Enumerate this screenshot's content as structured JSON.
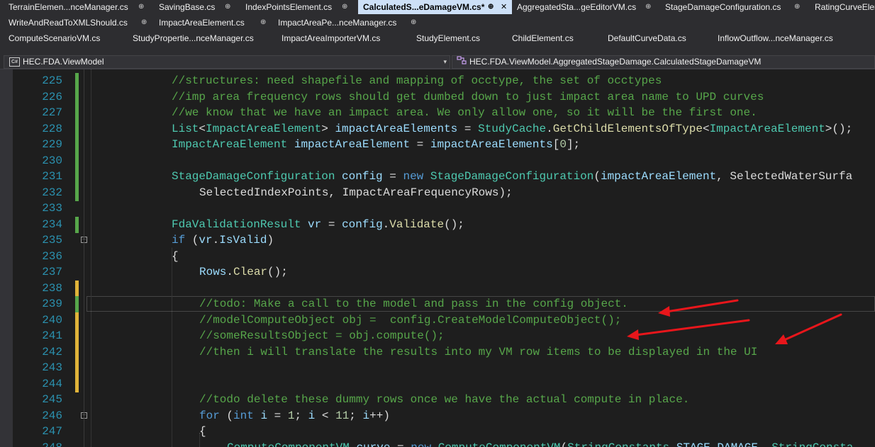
{
  "tabs": {
    "row1": [
      {
        "label": "TerrainElemen...nceManager.cs",
        "pin": "⊕"
      },
      {
        "label": "SavingBase.cs",
        "pin": "⊕"
      },
      {
        "label": "IndexPointsElement.cs",
        "pin": "⊕"
      },
      {
        "label": "CalculatedS...eDamageVM.cs*",
        "pin": "⊕",
        "close": "✕"
      },
      {
        "label": "AggregatedSta...geEditorVM.cs",
        "pin": "⊕"
      },
      {
        "label": "StageDamageConfiguration.cs",
        "pin": "⊕"
      },
      {
        "label": "RatingCurveEler"
      }
    ],
    "row2": [
      {
        "label": "WriteAndReadToXMLShould.cs",
        "pin": "⊕"
      },
      {
        "label": "ImpactAreaElement.cs",
        "pin": "⊕"
      },
      {
        "label": "ImpactAreaPe...nceManager.cs",
        "pin": "⊕"
      }
    ],
    "row3": [
      {
        "label": "ComputeScenarioVM.cs"
      },
      {
        "label": "StudyPropertie...nceManager.cs"
      },
      {
        "label": "ImpactAreaImporterVM.cs"
      },
      {
        "label": "StudyElement.cs"
      },
      {
        "label": "ChildElement.cs"
      },
      {
        "label": "DefaultCurveData.cs"
      },
      {
        "label": "InflowOutflow...nceManager.cs"
      }
    ]
  },
  "navbar": {
    "project": "HEC.FDA.ViewModel",
    "project_icon": "C#",
    "type_path": "HEC.FDA.ViewModel.AggregatedStageDamage.CalculatedStageDamageVM",
    "type_icon": "class-icon"
  },
  "editor": {
    "lines": [
      {
        "n": "225",
        "chg": "green",
        "indent": 0,
        "tokens": [
          [
            "cm",
            "//structures: need shapefile and mapping of occtype, the set of occtypes"
          ]
        ]
      },
      {
        "n": "226",
        "chg": "green",
        "indent": 0,
        "tokens": [
          [
            "cm",
            "//imp area frequency rows should get dumbed down to just impact area name to UPD curves"
          ]
        ]
      },
      {
        "n": "227",
        "chg": "green",
        "indent": 0,
        "tokens": [
          [
            "cm",
            "//we know that we have an impact area. We only allow one, so it will be the first one."
          ]
        ]
      },
      {
        "n": "228",
        "chg": "green",
        "indent": 0,
        "tokens": [
          [
            "ty",
            "List"
          ],
          [
            "pl",
            "<"
          ],
          [
            "ty",
            "ImpactAreaElement"
          ],
          [
            "pl",
            "> "
          ],
          [
            "id",
            "impactAreaElements"
          ],
          [
            "pl",
            " = "
          ],
          [
            "ty",
            "StudyCache"
          ],
          [
            "pl",
            "."
          ],
          [
            "mt",
            "GetChildElementsOfType"
          ],
          [
            "pl",
            "<"
          ],
          [
            "ty",
            "ImpactAreaElement"
          ],
          [
            "pl",
            ">();"
          ]
        ]
      },
      {
        "n": "229",
        "chg": "green",
        "indent": 0,
        "tokens": [
          [
            "ty",
            "ImpactAreaElement"
          ],
          [
            "pl",
            " "
          ],
          [
            "id",
            "impactAreaElement"
          ],
          [
            "pl",
            " = "
          ],
          [
            "id",
            "impactAreaElements"
          ],
          [
            "pl",
            "["
          ],
          [
            "nm",
            "0"
          ],
          [
            "pl",
            "];"
          ]
        ]
      },
      {
        "n": "230",
        "chg": "green",
        "indent": 0,
        "tokens": []
      },
      {
        "n": "231",
        "chg": "green",
        "indent": 0,
        "tokens": [
          [
            "ty",
            "StageDamageConfiguration"
          ],
          [
            "pl",
            " "
          ],
          [
            "id",
            "config"
          ],
          [
            "pl",
            " = "
          ],
          [
            "kw",
            "new"
          ],
          [
            "pl",
            " "
          ],
          [
            "ty",
            "StageDamageConfiguration"
          ],
          [
            "pl",
            "("
          ],
          [
            "id",
            "impactAreaElement"
          ],
          [
            "pl",
            ", SelectedWaterSurfa"
          ]
        ]
      },
      {
        "n": "232",
        "chg": "green",
        "indent": 1,
        "tokens": [
          [
            "pl",
            "SelectedIndexPoints, ImpactAreaFrequencyRows);"
          ]
        ]
      },
      {
        "n": "233",
        "chg": "",
        "indent": 0,
        "tokens": []
      },
      {
        "n": "234",
        "chg": "green",
        "indent": 0,
        "tokens": [
          [
            "ty",
            "FdaValidationResult"
          ],
          [
            "pl",
            " "
          ],
          [
            "id",
            "vr"
          ],
          [
            "pl",
            " = "
          ],
          [
            "id",
            "config"
          ],
          [
            "pl",
            "."
          ],
          [
            "mt",
            "Validate"
          ],
          [
            "pl",
            "();"
          ]
        ]
      },
      {
        "n": "235",
        "chg": "",
        "indent": 0,
        "fold": "−",
        "tokens": [
          [
            "kw",
            "if"
          ],
          [
            "pl",
            " ("
          ],
          [
            "id",
            "vr"
          ],
          [
            "pl",
            "."
          ],
          [
            "id",
            "IsValid"
          ],
          [
            "pl",
            ")"
          ]
        ]
      },
      {
        "n": "236",
        "chg": "",
        "indent": 0,
        "tokens": [
          [
            "pl",
            "{"
          ]
        ]
      },
      {
        "n": "237",
        "chg": "",
        "indent": 1,
        "tokens": [
          [
            "id",
            "Rows"
          ],
          [
            "pl",
            "."
          ],
          [
            "mt",
            "Clear"
          ],
          [
            "pl",
            "();"
          ]
        ]
      },
      {
        "n": "238",
        "chg": "yellow",
        "indent": 1,
        "tokens": []
      },
      {
        "n": "239",
        "chg": "green",
        "indent": 1,
        "tokens": [
          [
            "cm",
            "//todo: Make a call to the model and pass in the config object."
          ]
        ]
      },
      {
        "n": "240",
        "chg": "yellow",
        "indent": 1,
        "tokens": [
          [
            "cm",
            "//modelComputeObject obj =  config.CreateModelComputeObject();"
          ]
        ]
      },
      {
        "n": "241",
        "chg": "yellow",
        "indent": 1,
        "tokens": [
          [
            "cm",
            "//someResultsObject = obj.compute();"
          ]
        ]
      },
      {
        "n": "242",
        "chg": "yellow",
        "indent": 1,
        "tokens": [
          [
            "cm",
            "//then i will translate the results into my VM row items to be displayed in the UI"
          ]
        ]
      },
      {
        "n": "243",
        "chg": "yellow",
        "indent": 1,
        "tokens": []
      },
      {
        "n": "244",
        "chg": "yellow",
        "indent": 1,
        "tokens": []
      },
      {
        "n": "245",
        "chg": "",
        "indent": 1,
        "tokens": [
          [
            "cm",
            "//todo delete these dummy rows once we have the actual compute in place."
          ]
        ]
      },
      {
        "n": "246",
        "chg": "",
        "indent": 1,
        "fold": "−",
        "tokens": [
          [
            "kw",
            "for"
          ],
          [
            "pl",
            " ("
          ],
          [
            "kw",
            "int"
          ],
          [
            "pl",
            " "
          ],
          [
            "id",
            "i"
          ],
          [
            "pl",
            " = "
          ],
          [
            "nm",
            "1"
          ],
          [
            "pl",
            "; "
          ],
          [
            "id",
            "i"
          ],
          [
            "pl",
            " < "
          ],
          [
            "nm",
            "11"
          ],
          [
            "pl",
            "; "
          ],
          [
            "id",
            "i"
          ],
          [
            "pl",
            "++)"
          ]
        ]
      },
      {
        "n": "247",
        "chg": "",
        "indent": 1,
        "tokens": [
          [
            "pl",
            "{"
          ]
        ]
      },
      {
        "n": "248",
        "chg": "",
        "indent": 2,
        "tokens": [
          [
            "ty",
            "ComputeComponentVM"
          ],
          [
            "pl",
            " "
          ],
          [
            "id",
            "curve"
          ],
          [
            "pl",
            " = "
          ],
          [
            "kw",
            "new"
          ],
          [
            "pl",
            " "
          ],
          [
            "ty",
            "ComputeComponentVM"
          ],
          [
            "pl",
            "("
          ],
          [
            "ty",
            "StringConstants"
          ],
          [
            "pl",
            "."
          ],
          [
            "id",
            "STAGE_DAMAGE"
          ],
          [
            "pl",
            ", "
          ],
          [
            "ty",
            "StringConsta"
          ]
        ]
      }
    ]
  },
  "colors": {
    "change_green": "#57a64a",
    "change_yellow": "#e0b339",
    "annotation_arrow": "#e8161b",
    "active_tab_bg": "#cde0f7"
  }
}
